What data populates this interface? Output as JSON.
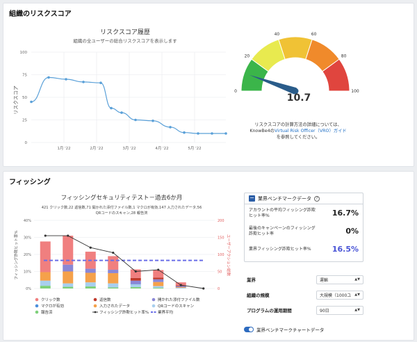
{
  "risk_section": {
    "title": "組織のリスクスコア",
    "gauge": {
      "value": 10.7,
      "value_label": "10.7",
      "ticks": [
        "0",
        "20",
        "40",
        "60",
        "80",
        "100"
      ],
      "segment_colors": [
        "#3bb54a",
        "#e8ea4f",
        "#f0c235",
        "#f08a2b",
        "#e0453e"
      ],
      "desc_line1": "リスクスコアの計算方法の詳細については、",
      "desc_prefix": "KnowBe4の",
      "desc_link": "Virtual Risk Officer（VRO）ガイド",
      "desc_line3": "を参照してください。"
    }
  },
  "phishing_section": {
    "title": "フィッシング",
    "benchmark": {
      "header": "業界ベンチマークデータ",
      "help_icon": "question-circle-icon",
      "rows": [
        {
          "label": "アカウントの平均フィッシング詐欺ヒット率%",
          "value": "16.7%"
        },
        {
          "label": "最後のキャンペーンのフィッシング詐欺ヒット率",
          "value": "0%"
        },
        {
          "label": "業界フィッシング詐欺ヒット率%",
          "value": "16.5%"
        }
      ]
    },
    "selects": [
      {
        "label": "業界",
        "value": "運輸"
      },
      {
        "label": "組織の規模",
        "value": "大規模（1000ユ"
      },
      {
        "label": "プログラムの運用期間",
        "value": "90日"
      }
    ],
    "toggle_label": "業界ベンチマークチャートデータ"
  },
  "chart_data": [
    {
      "type": "line",
      "title": "リスクスコア履歴",
      "subtitle": "組織の全ユーザーの総合リスクスコアを表示します",
      "ylabel": "リスクスコア",
      "xlabel": "",
      "ylim": [
        0,
        100
      ],
      "yticks": [
        "0",
        "25",
        "50",
        "75",
        "100"
      ],
      "xticks": [
        "1月 '22",
        "2月 '22",
        "3月 '22",
        "4月 '22",
        "5月 '22"
      ],
      "x": [
        0,
        0.5,
        1.0,
        1.5,
        2.0,
        2.3,
        2.6,
        3.0,
        3.5,
        4.0,
        4.4,
        4.8,
        5.2,
        5.6
      ],
      "values": [
        45,
        72,
        70,
        67,
        66,
        38,
        33,
        25,
        24,
        17,
        11,
        10,
        10,
        10
      ],
      "color": "#5aa0d8",
      "grid": true
    },
    {
      "type": "bar",
      "title": "フィッシングセキュリティテスト－過去6か月",
      "subtitle_line1": "421 クリック数,22 返信数,71 開かれた添付ファイル数,1 マクロが有効,147 入力されたデータ,56",
      "subtitle_line2": "QRコードのスキャン,28 報告済",
      "ylabel": "フィッシング詐欺ヒット率%",
      "y2label": "ユーザーアクション総数",
      "ylim": [
        0,
        40
      ],
      "y2lim": [
        0,
        200
      ],
      "yticks": [
        "0%",
        "10%",
        "20%",
        "30%",
        "40%"
      ],
      "y2ticks": [
        "0",
        "50",
        "100",
        "150",
        "200"
      ],
      "categories": [
        "1",
        "2",
        "3",
        "4",
        "5",
        "6",
        "7",
        "8"
      ],
      "series": [
        {
          "name": "クリック数",
          "color": "#f07f7f",
          "values": [
            90,
            85,
            50,
            40,
            25,
            22,
            9,
            0
          ]
        },
        {
          "name": "返信数",
          "color": "#c0392b",
          "values": [
            0,
            0,
            0,
            0,
            8,
            5,
            2,
            0
          ]
        },
        {
          "name": "開かれた添付ファイル数",
          "color": "#8a87d6",
          "values": [
            0,
            20,
            12,
            10,
            10,
            8,
            3,
            0
          ]
        },
        {
          "name": "マクロが有効",
          "color": "#4c8fdc",
          "values": [
            0,
            0,
            0,
            0,
            1,
            0,
            0,
            0
          ]
        },
        {
          "name": "入力されたデータ",
          "color": "#f5a14a",
          "values": [
            25,
            35,
            28,
            30,
            0,
            12,
            2,
            0
          ]
        },
        {
          "name": "QRコードのスキャン",
          "color": "#a8cfee",
          "values": [
            15,
            10,
            12,
            12,
            8,
            5,
            2,
            0
          ]
        },
        {
          "name": "報告済",
          "color": "#7ed07a",
          "values": [
            8,
            5,
            6,
            3,
            4,
            2,
            0,
            0
          ]
        }
      ],
      "line": {
        "name": "フィッシング詐欺ヒット率%",
        "values": [
          31,
          31,
          24,
          21,
          10,
          11,
          2,
          0
        ],
        "color": "#333333"
      },
      "reference": {
        "name": "業界平均",
        "value": 16.5,
        "color": "#6a6ee8"
      },
      "legend": "bottom"
    }
  ]
}
